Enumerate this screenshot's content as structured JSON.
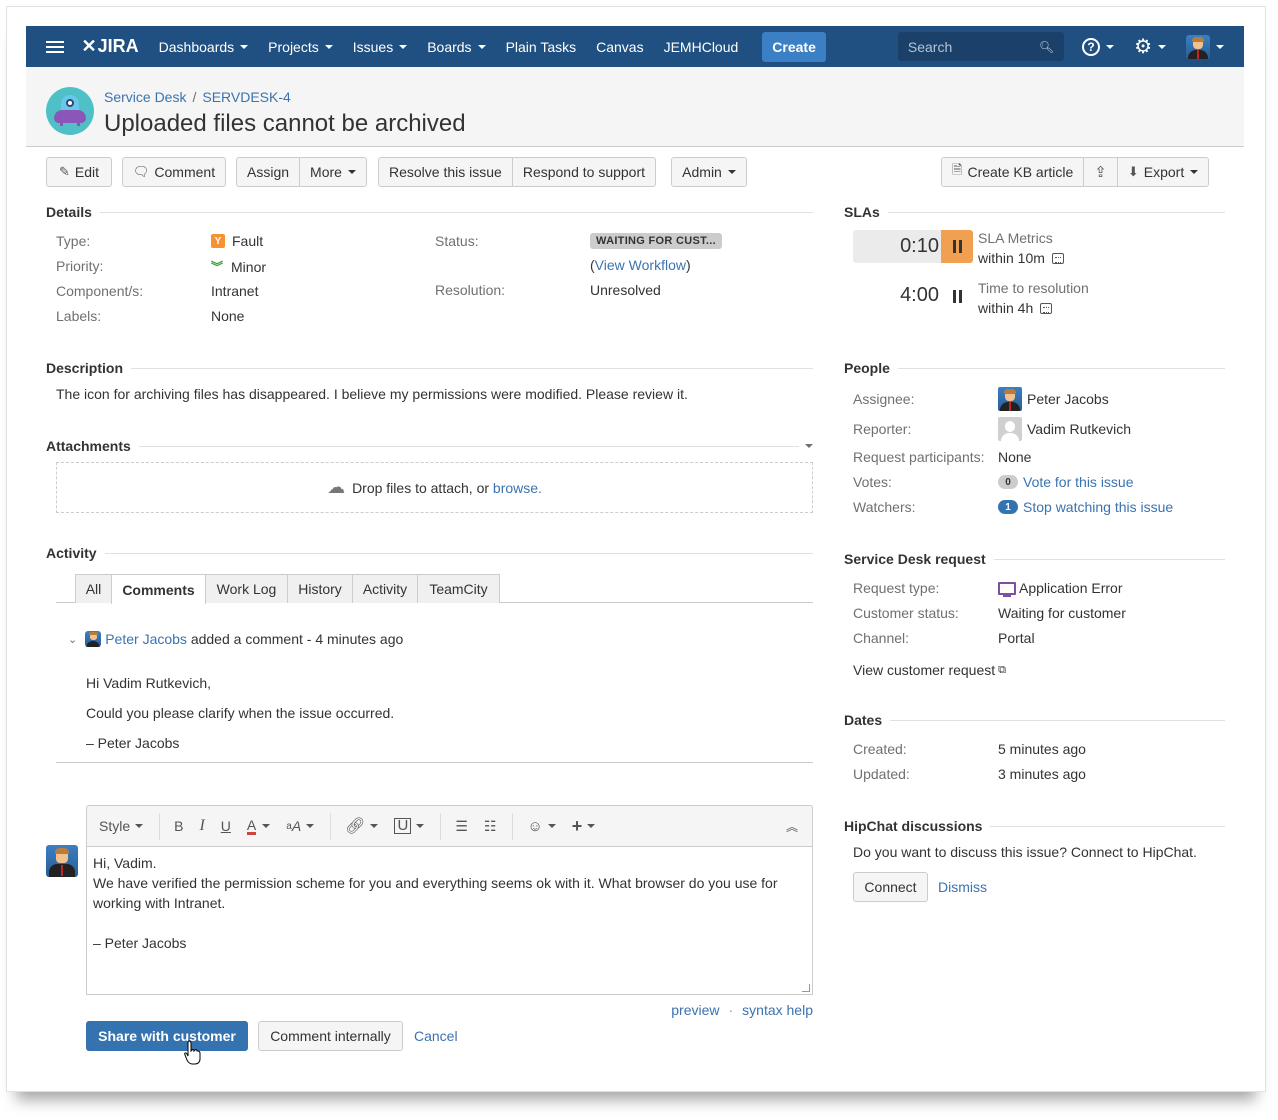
{
  "nav": {
    "app_name": "JIRA",
    "items": [
      {
        "label": "Dashboards",
        "dropdown": true
      },
      {
        "label": "Projects",
        "dropdown": true
      },
      {
        "label": "Issues",
        "dropdown": true
      },
      {
        "label": "Boards",
        "dropdown": true
      },
      {
        "label": "Plain Tasks",
        "dropdown": false
      },
      {
        "label": "Canvas",
        "dropdown": false
      },
      {
        "label": "JEMHCloud",
        "dropdown": false
      }
    ],
    "create_label": "Create",
    "search_placeholder": "Search",
    "help_glyph": "?",
    "settings_glyph": "⚙",
    "colors": {
      "bar": "#205081",
      "create": "#3b7fc4"
    }
  },
  "header": {
    "breadcrumb_project": "Service Desk",
    "breadcrumb_sep": "/",
    "breadcrumb_key": "SERVDESK-4",
    "title": "Uploaded files cannot be archived"
  },
  "toolbar": {
    "edit": "Edit",
    "comment": "Comment",
    "assign": "Assign",
    "more": "More",
    "resolve": "Resolve this issue",
    "respond": "Respond to support",
    "admin": "Admin",
    "create_kb": "Create KB article",
    "export": "Export"
  },
  "details": {
    "heading": "Details",
    "type_label": "Type:",
    "type_value": "Fault",
    "priority_label": "Priority:",
    "priority_value": "Minor",
    "component_label": "Component/s:",
    "component_value": "Intranet",
    "labels_label": "Labels:",
    "labels_value": "None",
    "status_label": "Status:",
    "status_value": "WAITING FOR CUST...",
    "view_workflow_open": "(",
    "view_workflow": "View Workflow",
    "view_workflow_close": ")",
    "resolution_label": "Resolution:",
    "resolution_value": "Unresolved"
  },
  "description": {
    "heading": "Description",
    "text": "The icon for archiving files has disappeared. I believe my permissions were modified. Please review it."
  },
  "attachments": {
    "heading": "Attachments",
    "drop_text": "Drop files to attach, or ",
    "browse": "browse."
  },
  "activity": {
    "heading": "Activity",
    "tabs": [
      "All",
      "Comments",
      "Work Log",
      "History",
      "Activity",
      "TeamCity"
    ],
    "active_tab": "Comments",
    "comment": {
      "author": "Peter Jacobs",
      "action": " added a comment - 4 minutes ago",
      "lines": [
        "Hi Vadim Rutkevich,",
        "Could you please clarify when the issue occurred.",
        "– Peter Jacobs"
      ]
    }
  },
  "editor": {
    "style_label": "Style",
    "lines": [
      "Hi, Vadim.",
      "We have verified the permission scheme for you and everything seems ok with it. What browser do you use for",
      "working with Intranet.",
      "",
      "– Peter Jacobs"
    ],
    "preview": "preview",
    "dot": "·",
    "syntax_help": "syntax help",
    "share": "Share with customer",
    "internal": "Comment internally",
    "cancel": "Cancel"
  },
  "slas": {
    "heading": "SLAs",
    "items": [
      {
        "time": "0:10",
        "name": "SLA Metrics",
        "goal": "within 10m",
        "state": "paused",
        "highlight": "#f0a050"
      },
      {
        "time": "4:00",
        "name": "Time to resolution",
        "goal": "within 4h",
        "state": "paused"
      }
    ]
  },
  "people": {
    "heading": "People",
    "assignee_label": "Assignee:",
    "assignee": "Peter Jacobs",
    "reporter_label": "Reporter:",
    "reporter": "Vadim Rutkevich",
    "participants_label": "Request participants:",
    "participants": "None",
    "votes_label": "Votes:",
    "votes_count": "0",
    "votes_link": "Vote for this issue",
    "watchers_label": "Watchers:",
    "watchers_count": "1",
    "watchers_link": "Stop watching this issue"
  },
  "sd_request": {
    "heading": "Service Desk request",
    "type_label": "Request type:",
    "type_value": "Application Error",
    "status_label": "Customer status:",
    "status_value": "Waiting for customer",
    "channel_label": "Channel:",
    "channel_value": "Portal",
    "view_link": "View customer request"
  },
  "dates": {
    "heading": "Dates",
    "created_label": "Created:",
    "created": "5 minutes ago",
    "updated_label": "Updated:",
    "updated": "3 minutes ago"
  },
  "hipchat": {
    "heading": "HipChat discussions",
    "text": "Do you want to discuss this issue? Connect to HipChat.",
    "connect": "Connect",
    "dismiss": "Dismiss"
  }
}
